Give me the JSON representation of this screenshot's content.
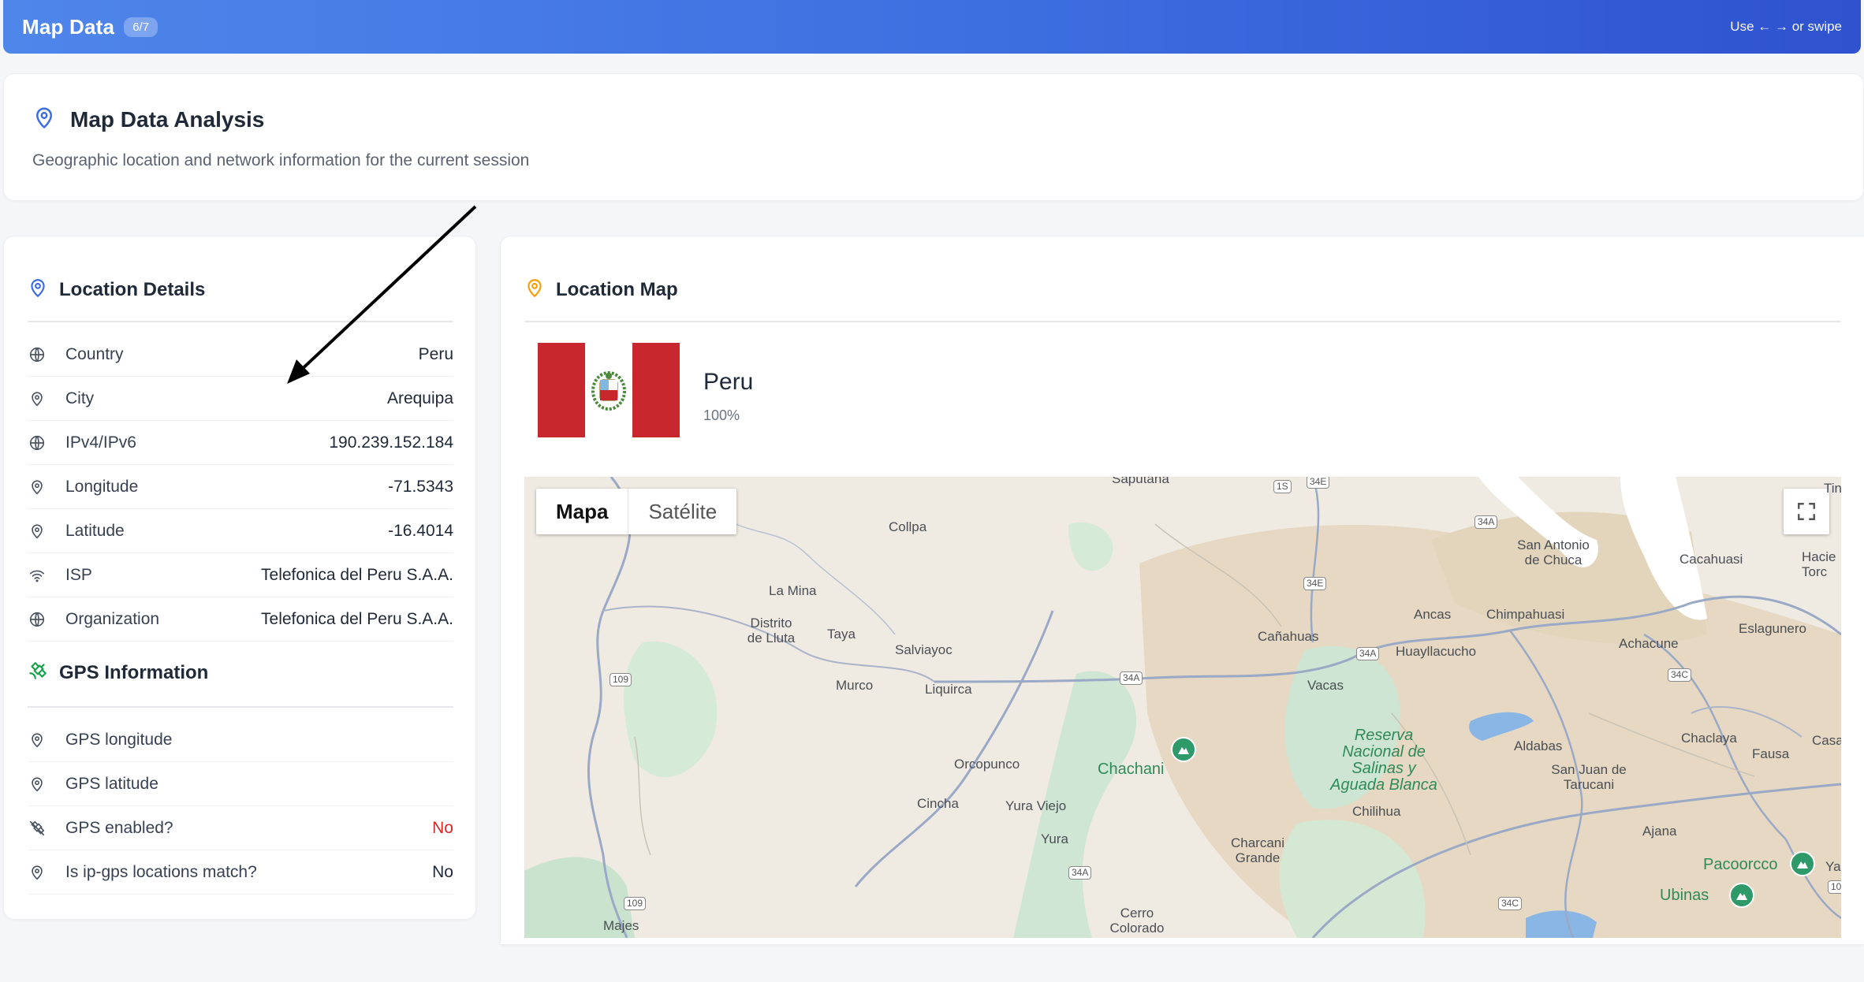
{
  "header": {
    "title": "Map Data",
    "badge": "6/7",
    "hint": "Use ← → or swipe"
  },
  "analysis": {
    "title": "Map Data Analysis",
    "description": "Geographic location and network information for the current session"
  },
  "location_details": {
    "title": "Location Details",
    "rows": [
      {
        "label": "Country",
        "value": "Peru",
        "icon": "globe-icon"
      },
      {
        "label": "City",
        "value": "Arequipa",
        "icon": "pin-icon"
      },
      {
        "label": "IPv4/IPv6",
        "value": "190.239.152.184",
        "icon": "globe-icon"
      },
      {
        "label": "Longitude",
        "value": "-71.5343",
        "icon": "pin-icon"
      },
      {
        "label": "Latitude",
        "value": "-16.4014",
        "icon": "pin-icon"
      },
      {
        "label": "ISP",
        "value": "Telefonica del Peru S.A.A.",
        "icon": "wifi-icon"
      },
      {
        "label": "Organization",
        "value": "Telefonica del Peru S.A.A.",
        "icon": "globe-icon"
      }
    ]
  },
  "gps_info": {
    "title": "GPS Information",
    "rows": [
      {
        "label": "GPS longitude",
        "value": "",
        "icon": "pin-icon"
      },
      {
        "label": "GPS latitude",
        "value": "",
        "icon": "pin-icon"
      },
      {
        "label": "GPS enabled?",
        "value": "No",
        "icon": "satellite-off-icon"
      },
      {
        "label": "Is ip-gps locations match?",
        "value": "No",
        "icon": "pin-icon"
      }
    ]
  },
  "location_map": {
    "title": "Location Map",
    "country": "Peru",
    "confidence": "100%",
    "map_type_options": [
      "Mapa",
      "Satélite"
    ],
    "selected_map_type": "Mapa",
    "places": [
      "Saputana",
      "Collpa",
      "La Mina",
      "Distrito de Lluta",
      "Taya",
      "Salviayoc",
      "Murco",
      "Liquirca",
      "Orcopunco",
      "Cincha",
      "Yura Viejo",
      "Yura",
      "Majes",
      "Chachani",
      "Cerro Colorado",
      "Charcani Grande",
      "Chilihua",
      "Reserva Nacional de Salinas y Aguada Blanca",
      "Cañahuas",
      "Vacas",
      "Huayllacucho",
      "Ancas",
      "Chimpahuasi",
      "San Antonio de Chuca",
      "Cacahuasi",
      "Hacie Torc",
      "Eslagunero",
      "Achacune",
      "Aldabas",
      "San Juan de Tarucani",
      "Chaclaya",
      "Fausa",
      "Casa",
      "Ajana",
      "Pacoorcco",
      "Ubinas",
      "Tin",
      "Ya"
    ],
    "road_shields": [
      "1S",
      "34E",
      "34A",
      "34E",
      "34A",
      "34A",
      "109",
      "34C",
      "34A",
      "34C",
      "109",
      "10"
    ]
  },
  "colors": {
    "accent_blue": "#3d6ee0",
    "icon_orange": "#f59e0b",
    "icon_green": "#16a34a",
    "negative_red": "#dc2626",
    "flag_red": "#c8272d"
  }
}
